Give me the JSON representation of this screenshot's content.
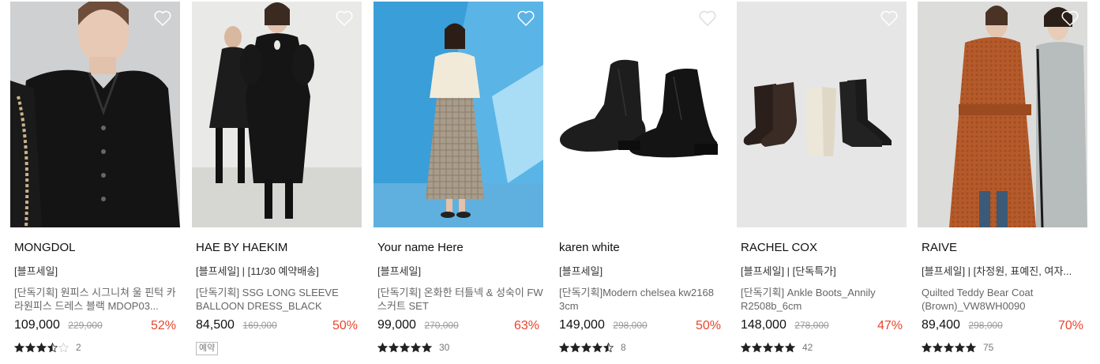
{
  "products": [
    {
      "brand": "MONGDOL",
      "tags": "[블프세일]",
      "title": "[단독기획] 원피스 시그니쳐 울 핀턱 카라원피스 드레스 블랙 MDOP03...",
      "price": "109,000",
      "original_price": "229,000",
      "discount": "52%",
      "rating_stars": 3.5,
      "review_count": "2",
      "badge": ""
    },
    {
      "brand": "HAE BY HAEKIM",
      "tags": "[블프세일] | [11/30 예약배송]",
      "title": "[단독기획] SSG LONG SLEEVE BALLOON DRESS_BLACK",
      "price": "84,500",
      "original_price": "169,000",
      "discount": "50%",
      "rating_stars": 0,
      "review_count": "",
      "badge": "예약"
    },
    {
      "brand": "Your name Here",
      "tags": "[블프세일]",
      "title": "[단독기획] 온화한 터틀넥 & 성숙이 FW 스커트 SET",
      "price": "99,000",
      "original_price": "270,000",
      "discount": "63%",
      "rating_stars": 5,
      "review_count": "30",
      "badge": ""
    },
    {
      "brand": "karen white",
      "tags": "[블프세일]",
      "title": "[단독기획]Modern chelsea kw2168 3cm",
      "price": "149,000",
      "original_price": "298,000",
      "discount": "50%",
      "rating_stars": 4.5,
      "review_count": "8",
      "badge": ""
    },
    {
      "brand": "RACHEL COX",
      "tags": "[블프세일] | [단독특가]",
      "title": "[단독기획] Ankle Boots_Annily R2508b_6cm",
      "price": "148,000",
      "original_price": "278,000",
      "discount": "47%",
      "rating_stars": 5,
      "review_count": "42",
      "badge": ""
    },
    {
      "brand": "RAIVE",
      "tags": "[블프세일] | [차정원, 표예진, 여자...",
      "title": "Quilted Teddy Bear Coat (Brown)_VW8WH0090",
      "price": "89,400",
      "original_price": "298,000",
      "discount": "70%",
      "rating_stars": 5,
      "review_count": "75",
      "badge": ""
    }
  ],
  "colors": {
    "discount": "#e8452c",
    "star": "#222222",
    "star_empty": "#cccccc"
  },
  "icons": {
    "wishlist": "heart-outline-icon",
    "rating": "star-icon"
  }
}
